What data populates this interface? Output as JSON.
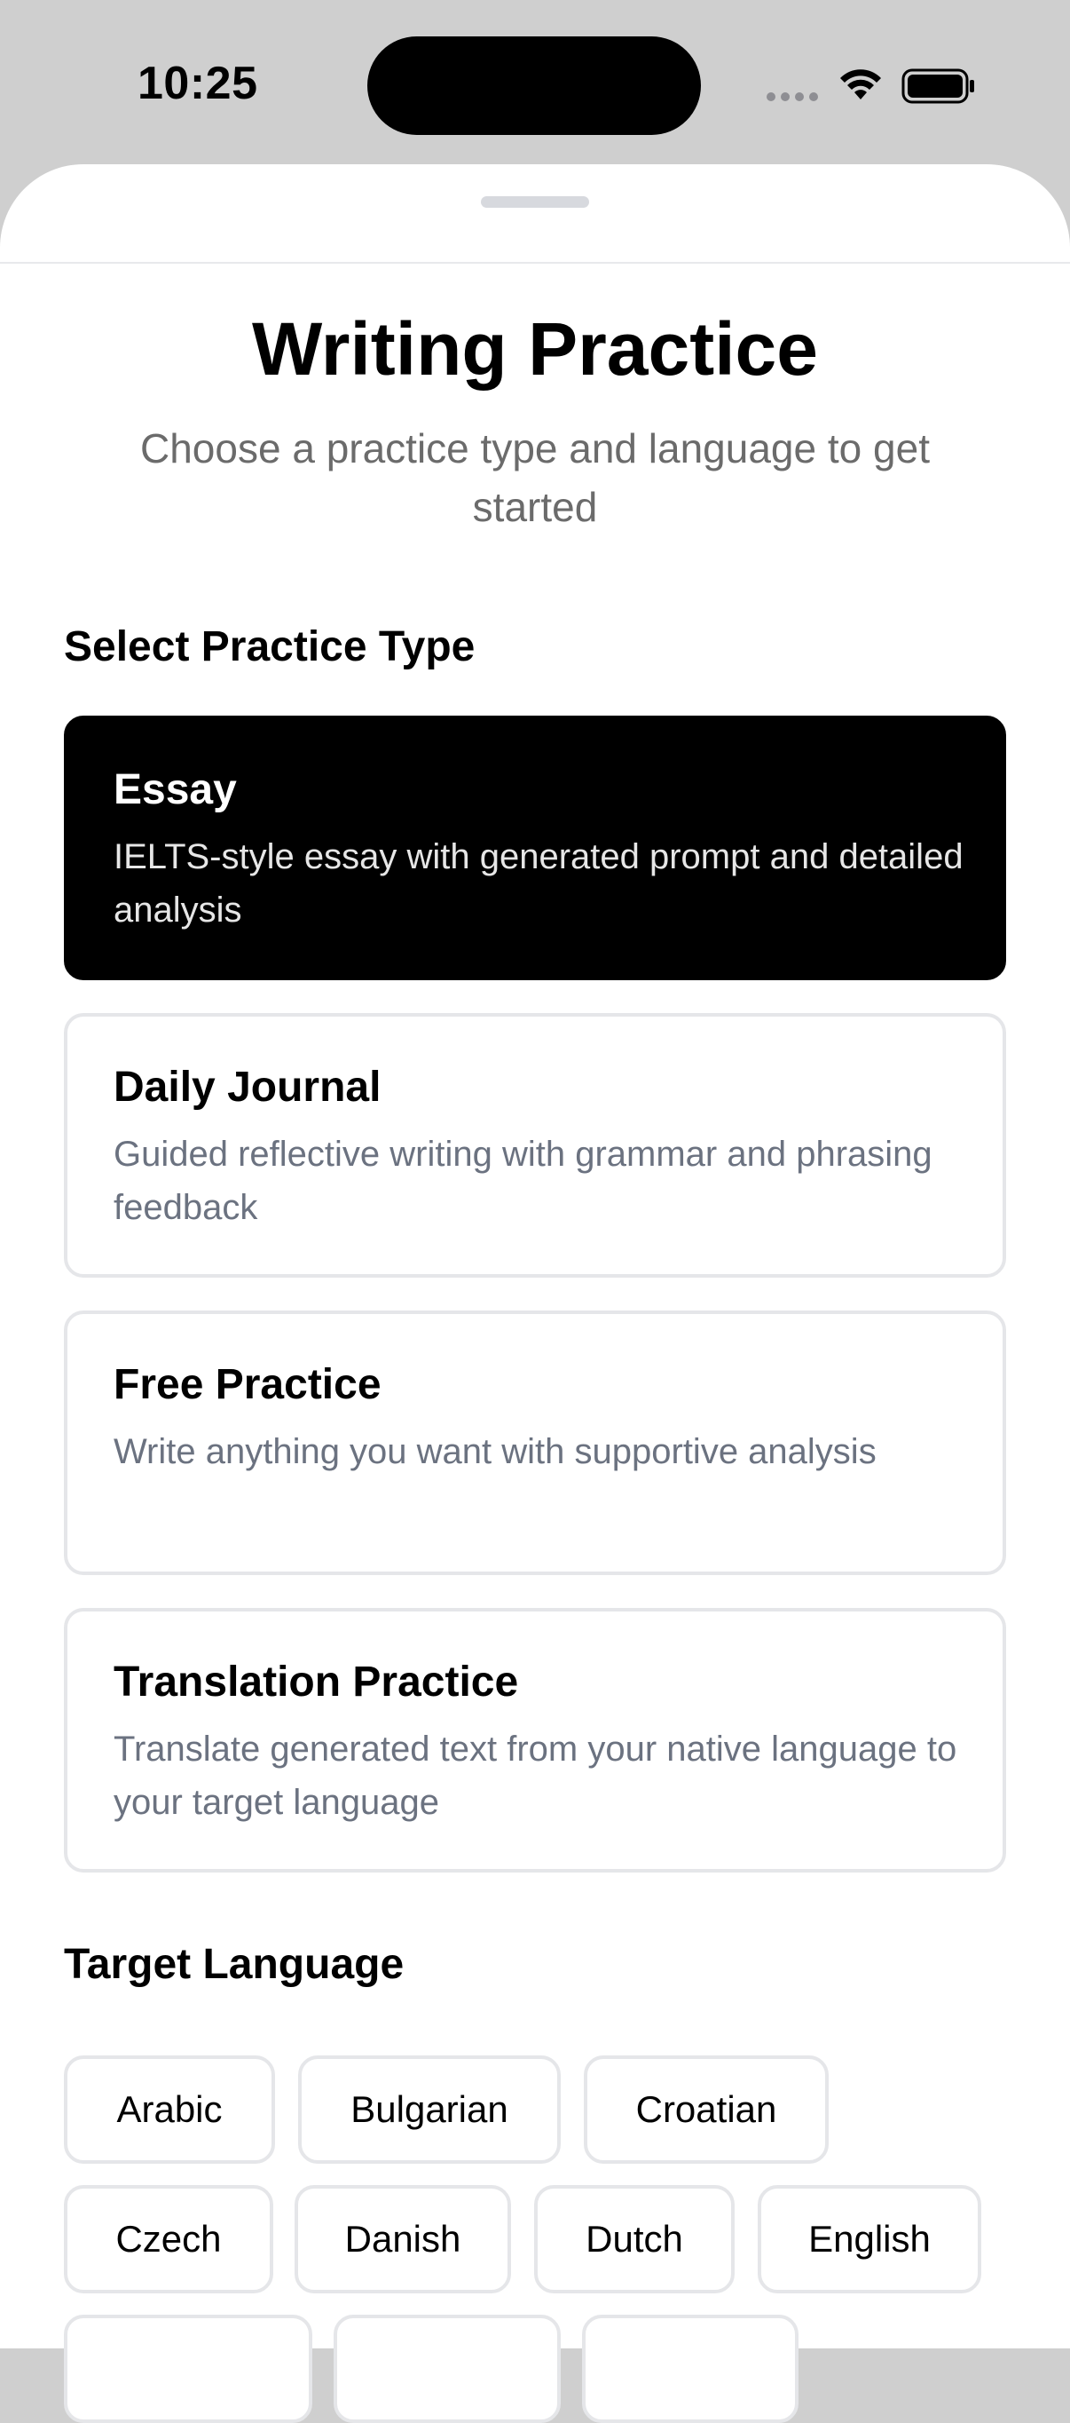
{
  "status_bar": {
    "time": "10:25"
  },
  "header": {
    "title": "Writing Practice",
    "subtitle": "Choose a practice type and language to get started"
  },
  "practice_section": {
    "heading": "Select Practice Type",
    "options": [
      {
        "title": "Essay",
        "description": "IELTS-style essay with generated prompt and detailed analysis",
        "selected": true
      },
      {
        "title": "Daily Journal",
        "description": "Guided reflective writing with grammar and phrasing feedback",
        "selected": false
      },
      {
        "title": "Free Practice",
        "description": "Write anything you want with supportive analysis",
        "selected": false
      },
      {
        "title": "Translation Practice",
        "description": "Translate generated text from your native language to your target language",
        "selected": false
      }
    ]
  },
  "language_section": {
    "heading": "Target Language",
    "languages": [
      "Arabic",
      "Bulgarian",
      "Croatian",
      "Czech",
      "Danish",
      "Dutch",
      "English"
    ]
  }
}
